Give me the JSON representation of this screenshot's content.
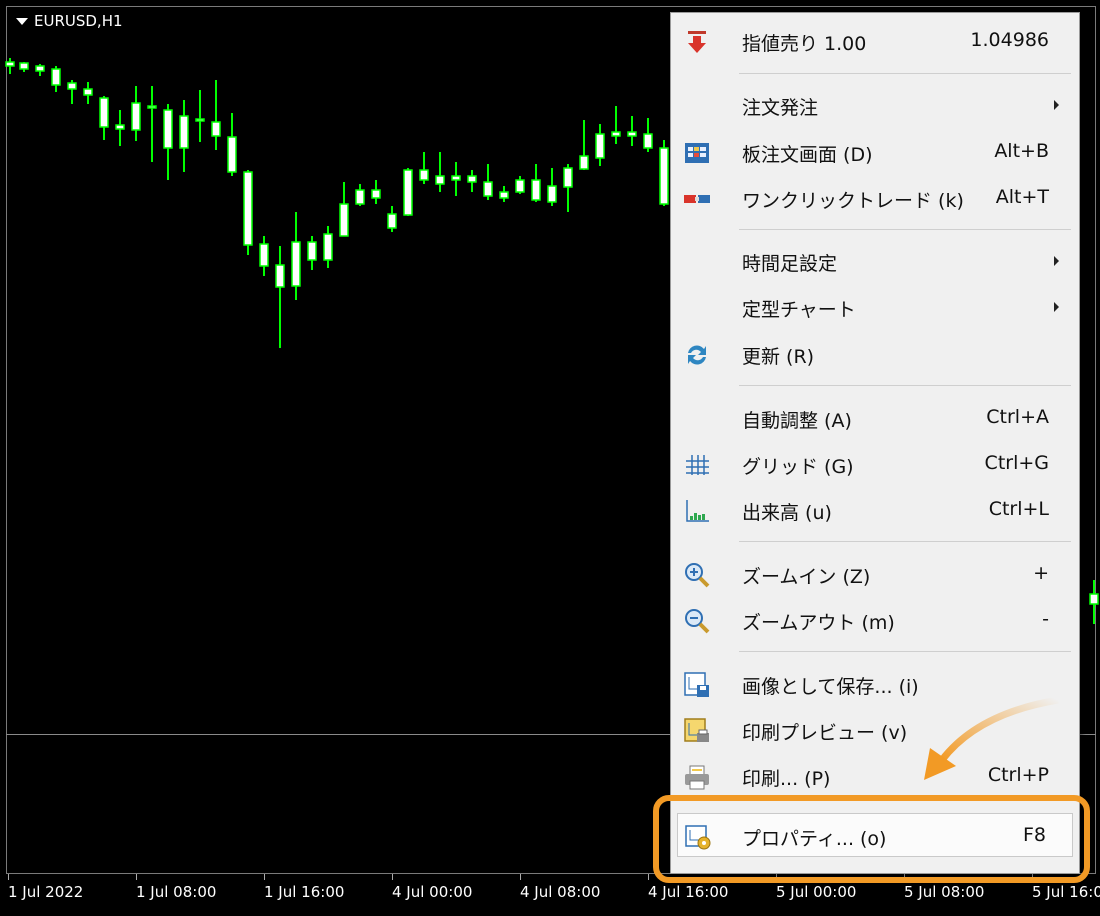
{
  "chart": {
    "symbol": "EURUSD,H1",
    "time_axis": [
      "1 Jul 2022",
      "1 Jul 08:00",
      "1 Jul 16:00",
      "4 Jul 00:00",
      "4 Jul 08:00",
      "4 Jul 16:00",
      "5 Jul 00:00",
      "5 Jul 08:00",
      "5 Jul 16:00"
    ],
    "bull_color": "#00ff00",
    "bear_fill": "#ffffff"
  },
  "menu": {
    "items": [
      {
        "label": "指値売り 1.00",
        "shortcut": "1.04986",
        "icon": "sell-arrow-icon"
      },
      {
        "label": "注文発注",
        "submenu": true
      },
      {
        "label": "板注文画面 (D)",
        "shortcut": "Alt+B",
        "icon": "depth-of-market-icon"
      },
      {
        "label": "ワンクリックトレード (k)",
        "shortcut": "Alt+T",
        "icon": "one-click-trading-icon"
      },
      {
        "label": "時間足設定",
        "submenu": true
      },
      {
        "label": "定型チャート",
        "submenu": true
      },
      {
        "label": "更新 (R)",
        "icon": "refresh-icon"
      },
      {
        "label": "自動調整 (A)",
        "shortcut": "Ctrl+A"
      },
      {
        "label": "グリッド (G)",
        "shortcut": "Ctrl+G",
        "icon": "grid-icon"
      },
      {
        "label": "出来高 (u)",
        "shortcut": "Ctrl+L",
        "icon": "volume-icon"
      },
      {
        "label": "ズームイン (Z)",
        "shortcut": "+",
        "icon": "zoom-in-icon"
      },
      {
        "label": "ズームアウト (m)",
        "shortcut": "-",
        "icon": "zoom-out-icon"
      },
      {
        "label": "画像として保存... (i)",
        "icon": "save-image-icon"
      },
      {
        "label": "印刷プレビュー (v)",
        "icon": "print-preview-icon"
      },
      {
        "label": "印刷... (P)",
        "shortcut": "Ctrl+P",
        "icon": "printer-icon"
      },
      {
        "label": "プロパティ... (o)",
        "shortcut": "F8",
        "icon": "properties-icon"
      }
    ]
  },
  "highlight_color": "#f29a25"
}
